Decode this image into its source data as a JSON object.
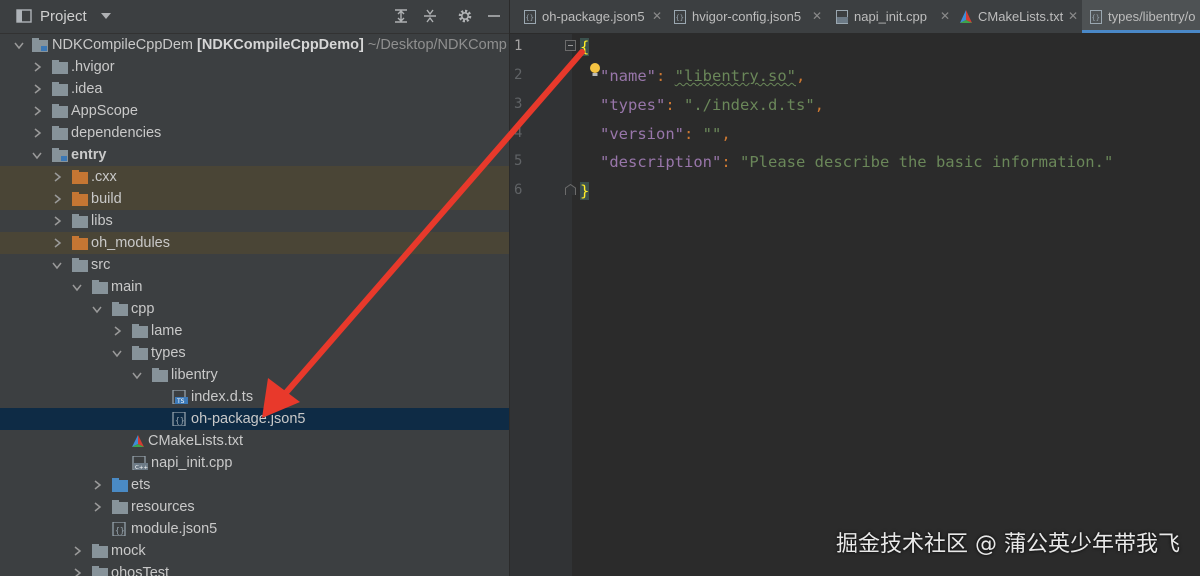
{
  "panel": {
    "title": "Project",
    "root_name": "NDKCompileCppDem",
    "root_module": "[NDKCompileCppDemo]",
    "root_path": "~/Desktop/NDKComp"
  },
  "tree": [
    {
      "label": ".hvigor"
    },
    {
      "label": ".idea"
    },
    {
      "label": "AppScope"
    },
    {
      "label": "dependencies"
    },
    {
      "label": "entry"
    },
    {
      "label": ".cxx"
    },
    {
      "label": "build"
    },
    {
      "label": "libs"
    },
    {
      "label": "oh_modules"
    },
    {
      "label": "src"
    },
    {
      "label": "main"
    },
    {
      "label": "cpp"
    },
    {
      "label": "lame"
    },
    {
      "label": "types"
    },
    {
      "label": "libentry"
    },
    {
      "label": "index.d.ts"
    },
    {
      "label": "oh-package.json5"
    },
    {
      "label": "CMakeLists.txt"
    },
    {
      "label": "napi_init.cpp"
    },
    {
      "label": "ets"
    },
    {
      "label": "resources"
    },
    {
      "label": "module.json5"
    },
    {
      "label": "mock"
    },
    {
      "label": "ohosTest"
    }
  ],
  "tabs": [
    {
      "label": "oh-package.json5"
    },
    {
      "label": "hvigor-config.json5"
    },
    {
      "label": "napi_init.cpp"
    },
    {
      "label": "CMakeLists.txt"
    },
    {
      "label": "types/libentry/o"
    }
  ],
  "editor": {
    "line_numbers": [
      "1",
      "2",
      "3",
      "4",
      "5",
      "6"
    ],
    "open_brace": "{",
    "close_brace": "}",
    "lines": [
      {
        "key": "\"name\"",
        "value": "\"libentry.so\"",
        "comma": ","
      },
      {
        "key": "\"types\"",
        "value": "\"./index.d.ts\"",
        "comma": ","
      },
      {
        "key": "\"version\"",
        "value": "\"\"",
        "comma": ","
      },
      {
        "key": "\"description\"",
        "value": "\"Please describe the basic information.\"",
        "comma": ""
      }
    ]
  },
  "watermark": "掘金技术社区 @ 蒲公英少年带我飞",
  "colors": {
    "panel_bg": "#3c3f41",
    "editor_bg": "#2b2b2b",
    "selection": "#0e2b45",
    "excluded": "#4a4536",
    "arrow": "#e8392b",
    "key": "#9876aa",
    "string": "#6a8759",
    "punct": "#cc7832"
  }
}
